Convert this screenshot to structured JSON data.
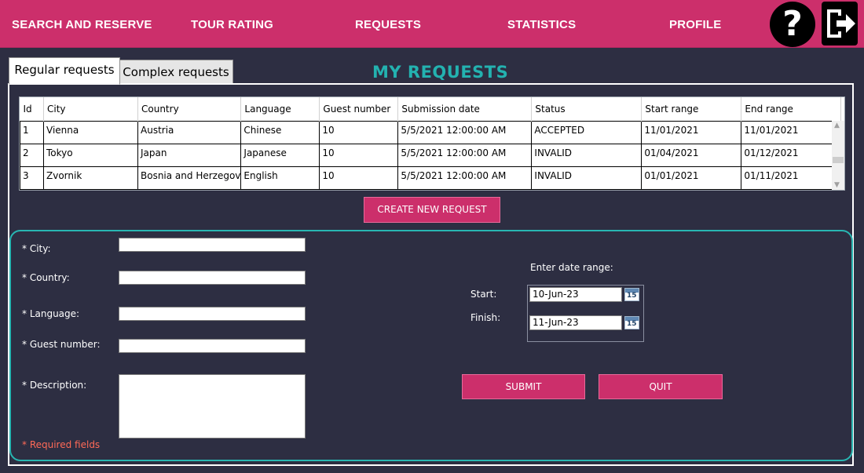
{
  "nav": {
    "items": [
      "SEARCH AND RESERVE",
      "TOUR RATING",
      "REQUESTS",
      "STATISTICS",
      "PROFILE"
    ],
    "help_label": "?",
    "icons": {
      "help": "question-mark-icon",
      "logout": "logout-arrow-icon"
    }
  },
  "tabs": [
    "Regular requests",
    "Complex requests"
  ],
  "title": "MY REQUESTS",
  "table": {
    "columns": [
      "Id",
      "City",
      "Country",
      "Language",
      "Guest number",
      "Submission date",
      "Status",
      "Start range",
      "End range"
    ],
    "rows": [
      [
        "1",
        "Vienna",
        "Austria",
        "Chinese",
        "10",
        "5/5/2021 12:00:00 AM",
        "ACCEPTED",
        "11/01/2021",
        "11/01/2021"
      ],
      [
        "2",
        "Tokyo",
        "Japan",
        "Japanese",
        "10",
        "5/5/2021 12:00:00 AM",
        "INVALID",
        "01/04/2021",
        "01/12/2021"
      ],
      [
        "3",
        "Zvornik",
        "Bosnia and Herzegov",
        "English",
        "10",
        "5/5/2021 12:00:00 AM",
        "INVALID",
        "01/01/2021",
        "01/11/2021"
      ]
    ]
  },
  "create_button": "CREATE NEW REQUEST",
  "form": {
    "city_label": "* City:",
    "country_label": "* Country:",
    "language_label": "* Language:",
    "guest_label": "* Guest number:",
    "description_label": "* Description:",
    "required_note": "* Required fields",
    "date_range_label": "Enter date range:",
    "start_label": "Start:",
    "finish_label": "Finish:",
    "start_value": "10-Jun-23",
    "finish_value": "11-Jun-23",
    "calendar_day": "15",
    "submit": "SUBMIT",
    "quit": "QUIT"
  },
  "colors": {
    "accent": "#cc2f6b",
    "title": "#23b2b0",
    "background": "#2d2e42",
    "required": "#ff6a57"
  }
}
